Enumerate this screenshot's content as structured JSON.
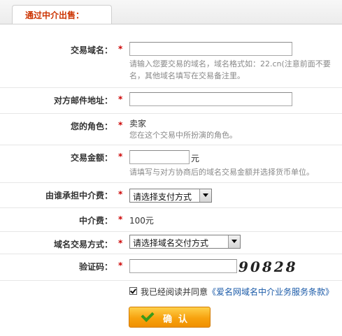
{
  "header": {
    "tab_title": "通过中介出售："
  },
  "form": {
    "domain": {
      "label": "交易域名：",
      "required": "*",
      "value": "",
      "hint_line1": "请输入您要交易的域名，域名格式如：22.cn(注意前面不要",
      "hint_line2": "名，其他域名填写在交易备注里。"
    },
    "email": {
      "label": "对方邮件地址：",
      "required": "*",
      "value": ""
    },
    "role": {
      "label": "您的角色：",
      "required": "*",
      "value": "卖家",
      "hint": "您在这个交易中所扮演的角色。"
    },
    "amount": {
      "label": "交易金额：",
      "required": "*",
      "value": "",
      "unit": "元",
      "hint": "请填写与对方协商后的域名交易金额并选择货币单位。"
    },
    "fee_payer": {
      "label": "由谁承担中介费：",
      "required": "*",
      "selected": "请选择支付方式"
    },
    "fee": {
      "label": "中介费：",
      "required": "*",
      "value": "100元"
    },
    "delivery": {
      "label": "域名交易方式：",
      "required": "*",
      "selected": "请选择域名交付方式"
    },
    "captcha": {
      "label": "验证码：",
      "required": "*",
      "value": "",
      "image_text": "90828"
    },
    "agree": {
      "checked": true,
      "text": "我已经阅读并同意",
      "link": "《爱名网域名中介业务服务条款》"
    },
    "submit_label": "确认"
  },
  "colors": {
    "accent": "#cc3300",
    "link": "#1a5aa8",
    "button": "#f7a20f"
  }
}
